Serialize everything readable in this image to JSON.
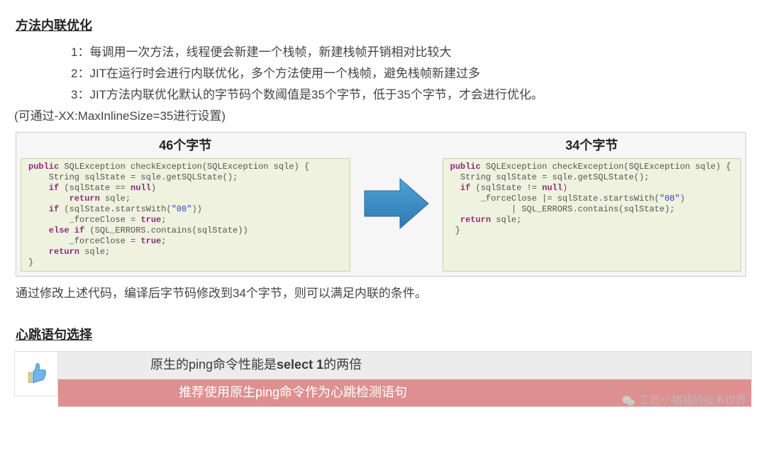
{
  "heading1": "方法内联优化",
  "bullets": [
    "1：每调用一次方法，线程便会新建一个栈帧，新建栈帧开销相对比较大",
    "2：JIT在运行时会进行内联优化，多个方法使用一个栈帧，避免栈帧新建过多",
    "3：JIT方法内联优化默认的字节码个数阈值是35个字节，低于35个字节，才会进行优化。"
  ],
  "setting_line": "(可通过-XX:MaxInlineSize=35进行设置)",
  "code_left": {
    "title": "46个字节",
    "l1a": "public",
    "l1b": " SQLException checkException(SQLException sqle) {",
    "l2": "    String sqlState = sqle.getSQLState();",
    "l3a": "    if",
    "l3b": " (sqlState == ",
    "l3c": "null",
    "l3d": ")",
    "l4a": "        return",
    "l4b": " sqle;",
    "l5a": "    if",
    "l5b": " (sqlState.startsWith(",
    "l5c": "\"08\"",
    "l5d": "))",
    "l6": "        _forceClose = ",
    "l6b": "true",
    "l6c": ";",
    "l7a": "    else if",
    "l7b": " (SQL_ERRORS.contains(sqlState))",
    "l8": "        _forceClose = ",
    "l8b": "true",
    "l8c": ";",
    "l9a": "    return",
    "l9b": " sqle;",
    "l10": "}"
  },
  "code_right": {
    "title": "34个字节",
    "r1a": "public",
    "r1b": " SQLException checkException(SQLException sqle) {",
    "r2": "  String sqlState = sqle.getSQLState();",
    "r3a": "  if",
    "r3b": " (sqlState != ",
    "r3c": "null",
    "r3d": ")",
    "r4": "      _forceClose |= sqlState.startsWith(",
    "r4b": "\"08\"",
    "r4c": ")",
    "r5": "            | SQL_ERRORS.contains(sqlState);",
    "r6a": "  return",
    "r6b": " sqle;",
    "r7": " }"
  },
  "para": "通过修改上述代码，编译后字节码修改到34个字节，则可以满足内联的条件。",
  "heading2": "心跳语句选择",
  "banner": {
    "line1_pre": "原生的ping命令性能是",
    "line1_bold": "select 1",
    "line1_post": "的两倍",
    "line2": "推荐使用原生ping命令作为心跳检测语句"
  },
  "watermark": "工匠小猪猪的技术世界"
}
